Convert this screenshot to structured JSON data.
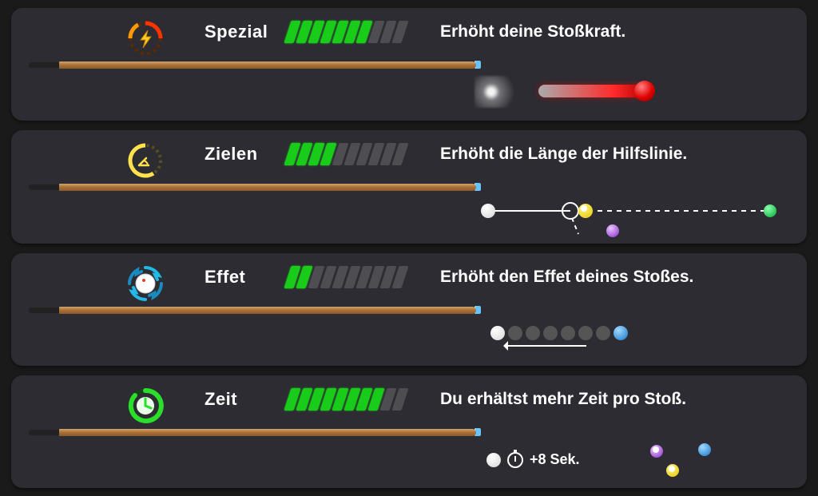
{
  "stats": [
    {
      "id": "spezial",
      "label": "Spezial",
      "value": 7,
      "max": 10,
      "description": "Erhöht deine Stoßkraft."
    },
    {
      "id": "zielen",
      "label": "Zielen",
      "value": 4,
      "max": 10,
      "description": "Erhöht die Länge der Hilfslinie."
    },
    {
      "id": "effet",
      "label": "Effet",
      "value": 2,
      "max": 10,
      "description": "Erhöht den Effet deines Stoßes."
    },
    {
      "id": "zeit",
      "label": "Zeit",
      "value": 8,
      "max": 10,
      "description": "Du erhältst mehr Zeit pro Stoß.",
      "bonus_text": "+8 Sek."
    }
  ],
  "colors": {
    "bar_on": "#1acc1a",
    "bar_off": "#4e4e52",
    "card_bg": "#2c2c32",
    "power_accent": "#ff6a00",
    "aim_accent": "#ffe24d",
    "spin_accent": "#22b9e8",
    "time_accent": "#2ade2a"
  }
}
